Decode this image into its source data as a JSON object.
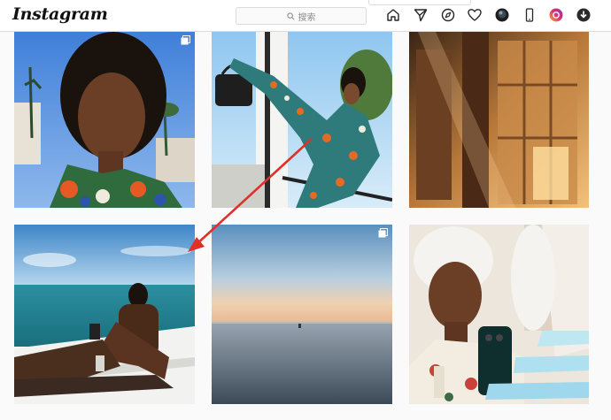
{
  "app": {
    "logo_text": "Instagram"
  },
  "search": {
    "placeholder": "搜索"
  },
  "nav": {
    "icons": [
      "home-icon",
      "direct-message-icon",
      "explore-icon",
      "activity-heart-icon",
      "avatar-icon",
      "mobile-device-icon",
      "instagram-app-icon",
      "download-icon"
    ]
  },
  "grid": {
    "posts": [
      {
        "name": "post-portrait-palm-trees",
        "multi": true
      },
      {
        "name": "post-floral-outfit-handbag",
        "multi": false
      },
      {
        "name": "post-sunlit-building",
        "multi": false
      },
      {
        "name": "post-yacht-ocean",
        "multi": false
      },
      {
        "name": "post-calm-sea-horizon",
        "multi": true
      },
      {
        "name": "post-mirror-selfie-towel",
        "multi": false
      }
    ]
  },
  "annotation": {
    "type": "red-arrow",
    "color": "#e0302a"
  },
  "colors": {
    "accent": "#e0302a",
    "border": "#dbdbdb",
    "text": "#262626"
  }
}
